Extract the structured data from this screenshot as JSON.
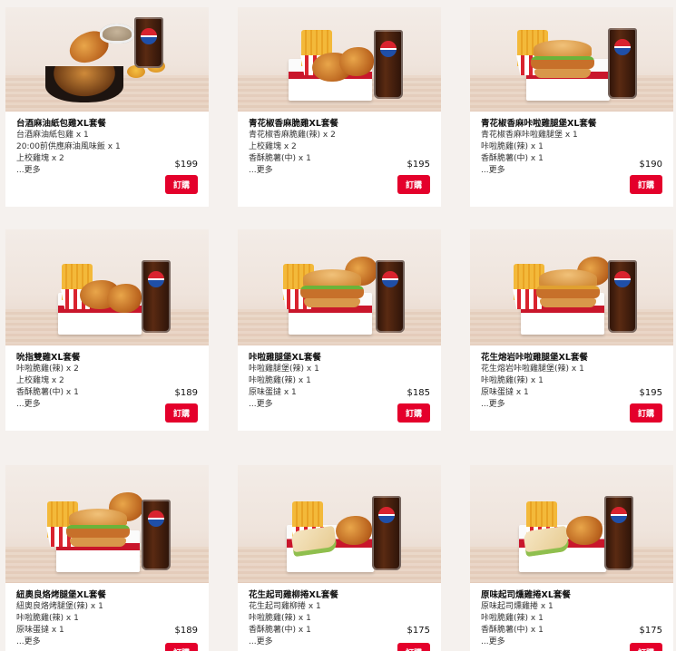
{
  "order_label": "訂購",
  "more_label": "...更多",
  "products": [
    {
      "title": "台酒麻油紙包雞XL套餐",
      "items": [
        "台酒麻油紙包雞 x 1",
        "20:00前供應麻油風味飯 x 1",
        "上校雞塊 x 2"
      ],
      "price": "$199"
    },
    {
      "title": "青花椒香麻脆雞XL套餐",
      "items": [
        "青花椒香麻脆雞(辣) x 2",
        "上校雞塊 x 2",
        "香酥脆薯(中) x 1"
      ],
      "price": "$195"
    },
    {
      "title": "青花椒香麻咔啦雞腿堡XL套餐",
      "items": [
        "青花椒香麻咔啦雞腿堡 x 1",
        "咔啦脆雞(辣) x 1",
        "香酥脆薯(中) x 1"
      ],
      "price": "$190"
    },
    {
      "title": "吮指雙雞XL套餐",
      "items": [
        "咔啦脆雞(辣) x 2",
        "上校雞塊 x 2",
        "香酥脆薯(中) x 1"
      ],
      "price": "$189"
    },
    {
      "title": "咔啦雞腿堡XL套餐",
      "items": [
        "咔啦雞腿堡(辣) x 1",
        "咔啦脆雞(辣) x 1",
        "原味蛋撻 x 1"
      ],
      "price": "$185"
    },
    {
      "title": "花生熔岩咔啦雞腿堡XL套餐",
      "items": [
        "花生熔岩咔啦雞腿堡(辣) x 1",
        "咔啦脆雞(辣) x 1",
        "原味蛋撻 x 1"
      ],
      "price": "$195"
    },
    {
      "title": "紐奧良烙烤腿堡XL套餐",
      "items": [
        "紐奧良烙烤腿堡(辣) x 1",
        "咔啦脆雞(辣) x 1",
        "原味蛋撻 x 1"
      ],
      "price": "$189"
    },
    {
      "title": "花生起司雞柳捲XL套餐",
      "items": [
        "花生起司雞柳捲 x 1",
        "咔啦脆雞(辣) x 1",
        "香酥脆薯(中) x 1"
      ],
      "price": "$175"
    },
    {
      "title": "原味起司燻雞捲XL套餐",
      "items": [
        "原味起司燻雞捲 x 1",
        "咔啦脆雞(辣) x 1",
        "香酥脆薯(中) x 1"
      ],
      "price": "$175"
    }
  ]
}
